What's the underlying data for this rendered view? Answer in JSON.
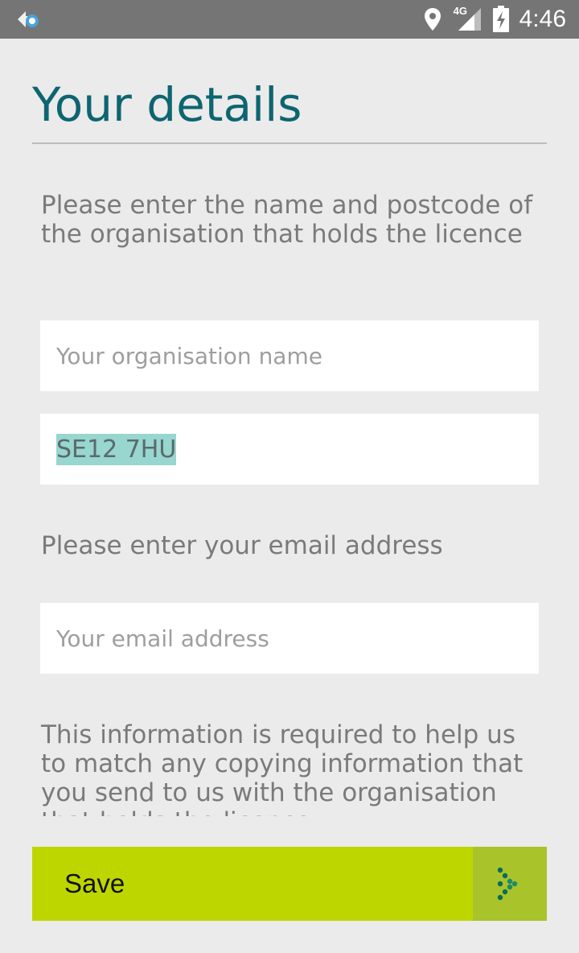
{
  "status_bar": {
    "network": "4G",
    "time": "4:46",
    "icons": [
      "app-notification-icon",
      "location-icon",
      "signal-icon",
      "battery-charging-icon"
    ]
  },
  "page": {
    "title": "Your details",
    "org_instruction": "Please enter the name and postcode of the organisation that holds the licence",
    "org_name_input": {
      "placeholder": "Your organisation name",
      "value": ""
    },
    "postcode_input": {
      "value": "SE12 7HU"
    },
    "email_instruction": "Please enter your email address",
    "email_input": {
      "placeholder": "Your email address",
      "value": ""
    },
    "info_text": "This information is required to help us to match any copying information that you send to us with the organisation that holds the licence"
  },
  "footer": {
    "save_label": "Save",
    "save_icon": "dotted-arrow-icon"
  },
  "colors": {
    "title": "#0d6570",
    "accent_green": "#bed600",
    "selection": "#98d6d0"
  }
}
